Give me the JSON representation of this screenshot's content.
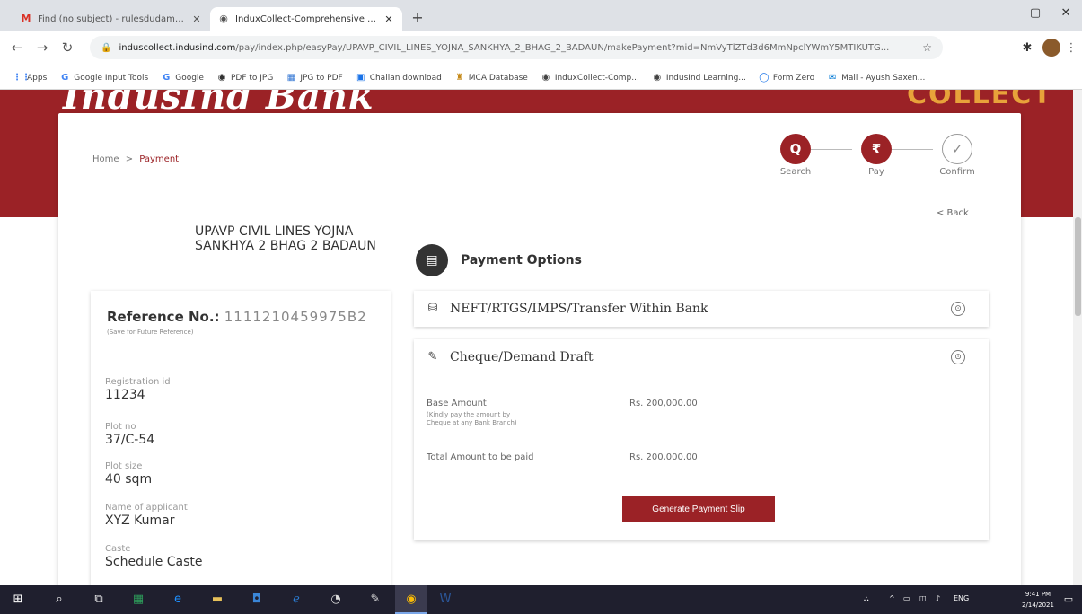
{
  "browser": {
    "tabs": [
      {
        "title": "Find (no subject) - rulesdudamri@gmail.com",
        "active": false,
        "icon": "gmail-icon"
      },
      {
        "title": "InduxCollect-Comprehensive Collection",
        "active": true,
        "icon": "chrome-icon"
      }
    ],
    "url_host": "induscollect.indusind.com",
    "url_path": "/pay/index.php/easyPay/UPAVP_CIVIL_LINES_YOJNA_SANKHYA_2_BHAG_2_BADAUN/makePayment?mid=NmVyTlZTd3d6MmNpclYWmY5MTIKUTG...",
    "bookmarks": [
      {
        "label": "Apps",
        "icon": "apps-icon"
      },
      {
        "label": "Google Input Tools",
        "icon": "google-icon"
      },
      {
        "label": "Google",
        "icon": "google-icon"
      },
      {
        "label": "PDF to JPG",
        "icon": "pdf-icon"
      },
      {
        "label": "JPG to PDF",
        "icon": "jpg-icon"
      },
      {
        "label": "Challan download",
        "icon": "challan-icon"
      },
      {
        "label": "MCA Database",
        "icon": "mca-icon"
      },
      {
        "label": "InduxCollect-Comp...",
        "icon": "globe-icon"
      },
      {
        "label": "IndusInd Learning...",
        "icon": "globe-icon"
      },
      {
        "label": "Form Zero",
        "icon": "form-icon"
      },
      {
        "label": "Mail - Ayush Saxen...",
        "icon": "mail-icon"
      }
    ]
  },
  "brand": {
    "name": "IndusInd Bank",
    "product": "COLLECT",
    "color": "#9b2226"
  },
  "breadcrumb": {
    "home": "Home",
    "separator": ">",
    "current": "Payment"
  },
  "steps": [
    {
      "label": "Search",
      "icon": "search-icon",
      "glyph": "Q",
      "state": "done"
    },
    {
      "label": "Pay",
      "icon": "rupee-icon",
      "glyph": "₹",
      "state": "done"
    },
    {
      "label": "Confirm",
      "icon": "check-icon",
      "glyph": "✓",
      "state": "pending"
    }
  ],
  "back_label": "< Back",
  "estate_name": "UPAVP CIVIL LINES YOJNA SANKHYA 2 BHAG 2 BADAUN",
  "reference": {
    "label": "Reference No.:",
    "number": "1111210459975B2",
    "note": "(Save for Future Reference)"
  },
  "fields": [
    {
      "label": "Registration id",
      "value": "11234"
    },
    {
      "label": "Plot no",
      "value": "37/C-54"
    },
    {
      "label": "Plot size",
      "value": "40 sqm"
    },
    {
      "label": "Name of applicant",
      "value": "XYZ Kumar"
    },
    {
      "label": "Caste",
      "value": "Schedule Caste"
    }
  ],
  "payment_options": {
    "title": "Payment Options",
    "neft": {
      "title": "NEFT/RTGS/IMPS/Transfer Within Bank",
      "toggle": "⊙"
    },
    "cheque": {
      "title": "Cheque/Demand Draft",
      "toggle": "⊙",
      "base_amount_label": "Base Amount",
      "base_amount_note": "(Kindly pay the amount by Cheque at any Bank Branch)",
      "base_amount": "Rs. 200,000.00",
      "total_label": "Total Amount to be paid",
      "total": "Rs. 200,000.00",
      "button": "Generate Payment Slip"
    }
  },
  "taskbar": {
    "lang": "ENG",
    "time": "9:41 PM",
    "date": "2/14/2021"
  }
}
